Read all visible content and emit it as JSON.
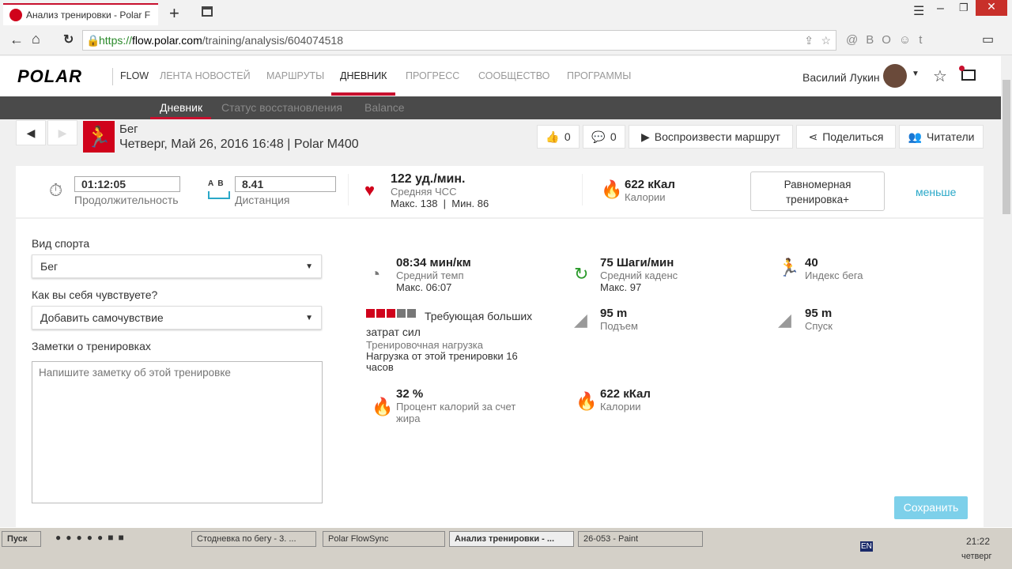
{
  "browser": {
    "tab_title": "Анализ тренировки - Polar F",
    "url_scheme": "https://",
    "url_domain": "flow.polar.com",
    "url_path": "/training/analysis/604074518"
  },
  "header": {
    "logo": "POLAR",
    "flow": "FLOW",
    "nav": [
      "ЛЕНТА НОВОСТЕЙ",
      "МАРШРУТЫ",
      "ДНЕВНИК",
      "ПРОГРЕСС",
      "СООБЩЕСТВО",
      "ПРОГРАММЫ"
    ],
    "user": "Василий Лукин"
  },
  "subnav": [
    "Дневник",
    "Статус восстановления",
    "Balance"
  ],
  "session": {
    "sport": "Бег",
    "date": "Четверг, Май 26, 2016 16:48 | Polar M400",
    "likes": "0",
    "comments": "0",
    "replay": "Воспроизвести маршрут",
    "share": "Поделиться",
    "readers": "Читатели"
  },
  "summary": {
    "duration": "01:12:05",
    "duration_label": "Продолжительность",
    "ab": "A  B",
    "distance": "8.41",
    "distance_label": "Дистанция",
    "hr": "122 уд./мин.",
    "hr_label": "Средняя ЧСС",
    "hr_range": "Макс. 138  |  Мин. 86",
    "cal": "622 кКал",
    "cal_label": "Калории",
    "benefit": "Равномерная тренировка+",
    "less": "меньше"
  },
  "form": {
    "sport_label": "Вид спорта",
    "sport_value": "Бег",
    "feel_label": "Как вы себя чувствуете?",
    "feel_value": "Добавить самочувствие",
    "notes_label": "Заметки о тренировках",
    "notes_placeholder": "Напишите заметку об этой тренировке",
    "save": "Сохранить"
  },
  "stats": {
    "pace": "08:34 мин/км",
    "pace_label": "Средний темп",
    "pace_max": "Макс. 06:07",
    "cadence": "75 Шаги/мин",
    "cadence_label": "Средний каденс",
    "cadence_max": "Макс. 97",
    "index": "40",
    "index_label": "Индекс бега",
    "load_text": "Требующая больших затрат сил",
    "load_label": "Тренировочная нагрузка",
    "load_detail": "Нагрузка от этой тренировки 16 часов",
    "load_level": 3,
    "ascent": "95 m",
    "ascent_label": "Подъем",
    "descent": "95 m",
    "descent_label": "Спуск",
    "fat": "32 %",
    "fat_label": "Процент калорий за счет жира",
    "cal2": "622 кКал",
    "cal2_label": "Калории"
  },
  "taskbar": {
    "start": "Пуск",
    "items": [
      "Стодневка по бегу - 3. ...",
      "Polar FlowSync",
      "Анализ тренировки - ...",
      "26-053 - Paint"
    ],
    "lang": "EN",
    "time": "21:22",
    "day": "четверг"
  },
  "colors": {
    "accent": "#c8102e",
    "link": "#2aa8c8",
    "save": "#7dd0ea"
  }
}
